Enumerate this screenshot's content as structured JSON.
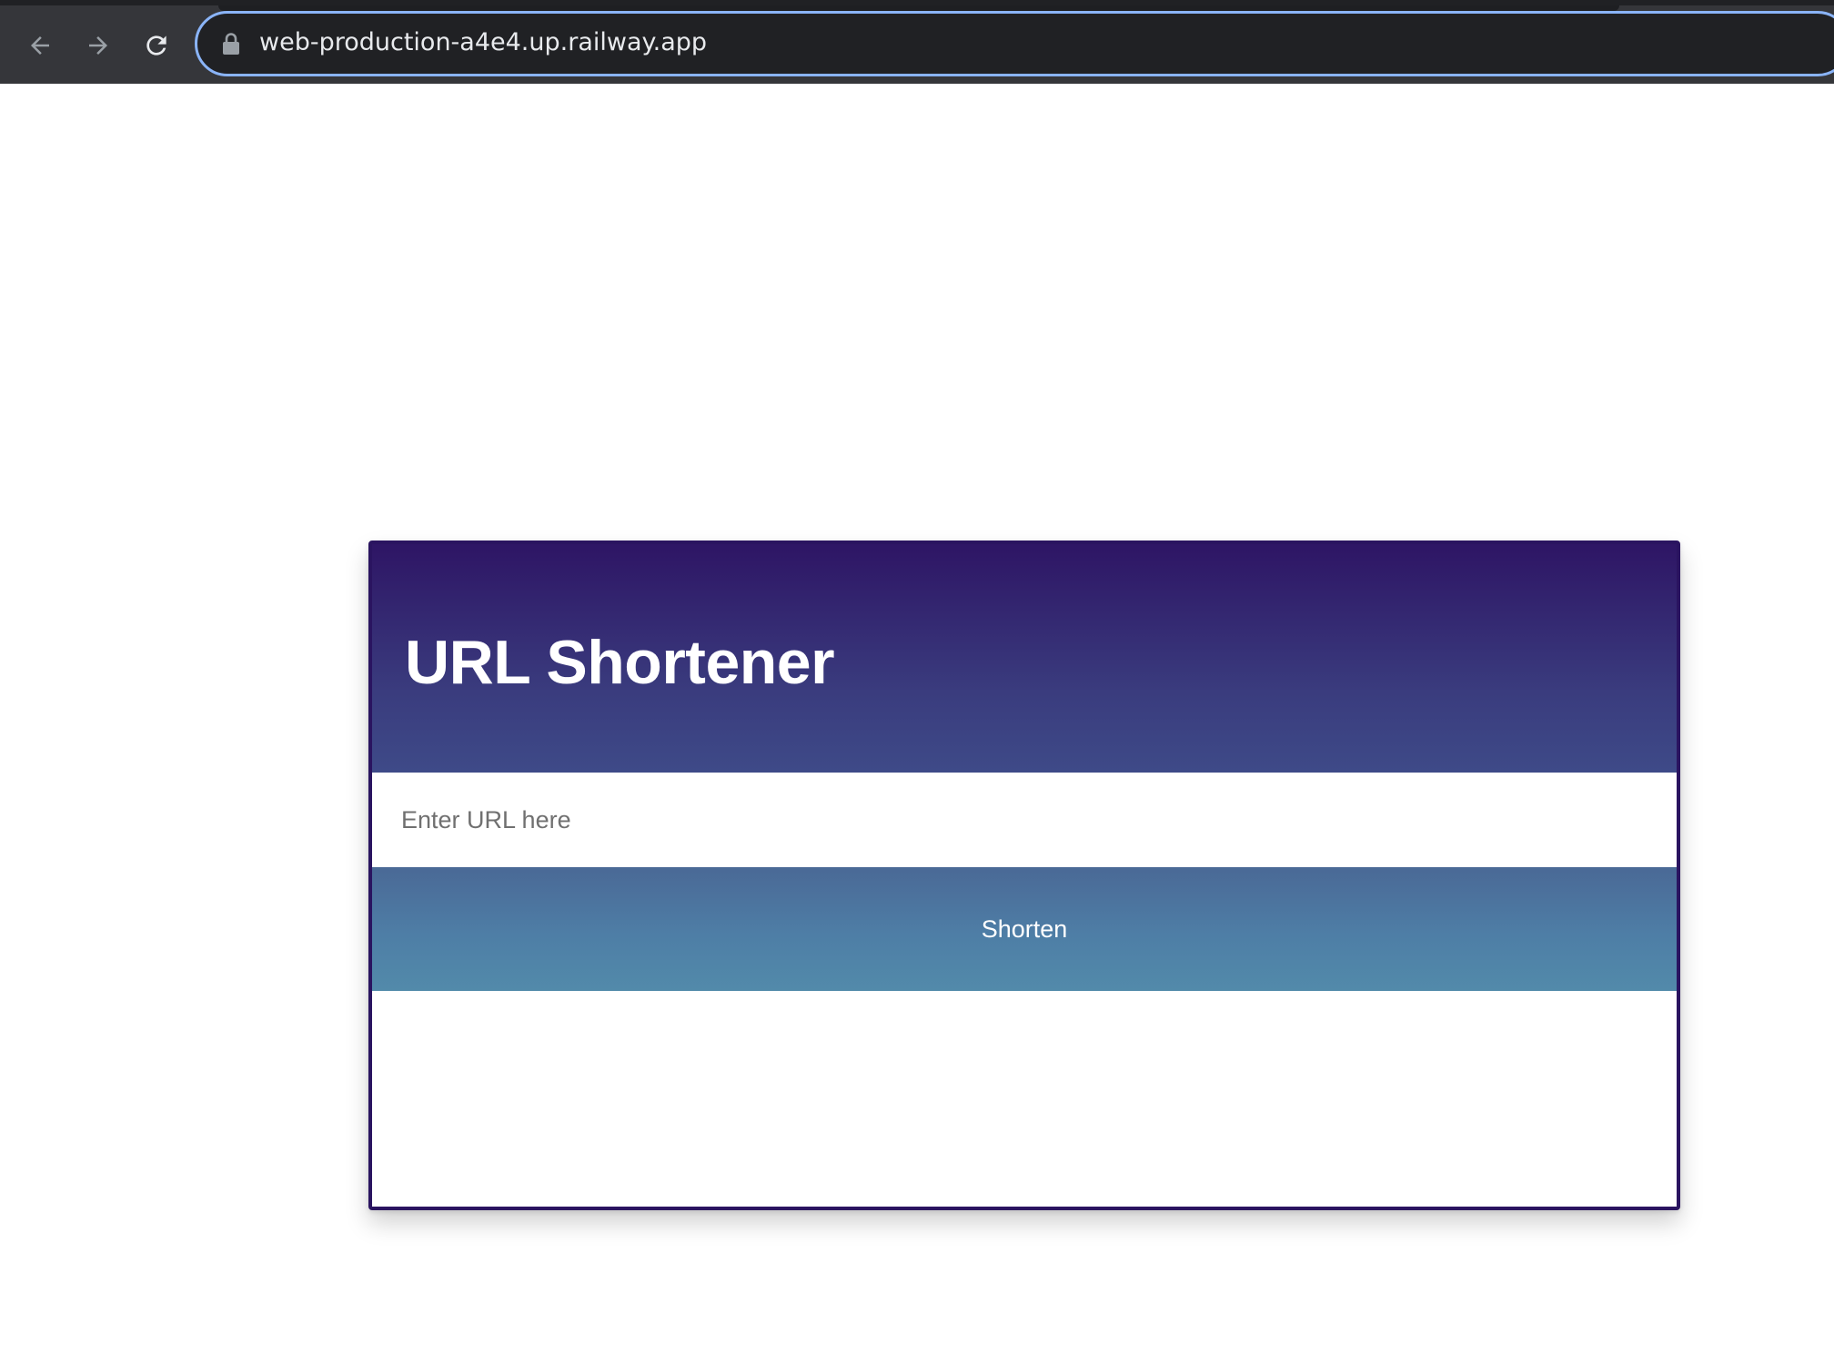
{
  "browser": {
    "url": "web-production-a4e4.up.railway.app",
    "icons": {
      "back": "arrow-left-icon",
      "forward": "arrow-right-icon",
      "reload": "reload-icon",
      "lock": "lock-icon"
    },
    "colors": {
      "toolbar": "#35363a",
      "omnibox_bg": "#202124",
      "omnibox_focus": "#8ab4f8"
    }
  },
  "app": {
    "title": "URL Shortener",
    "input": {
      "placeholder": "Enter URL here",
      "value": ""
    },
    "button_label": "Shorten",
    "colors": {
      "header_top": "#2e1565",
      "header_bottom": "#3e4a88",
      "button_top": "#4a6996",
      "button_bottom": "#528aaa",
      "border": "#2a1460"
    }
  }
}
